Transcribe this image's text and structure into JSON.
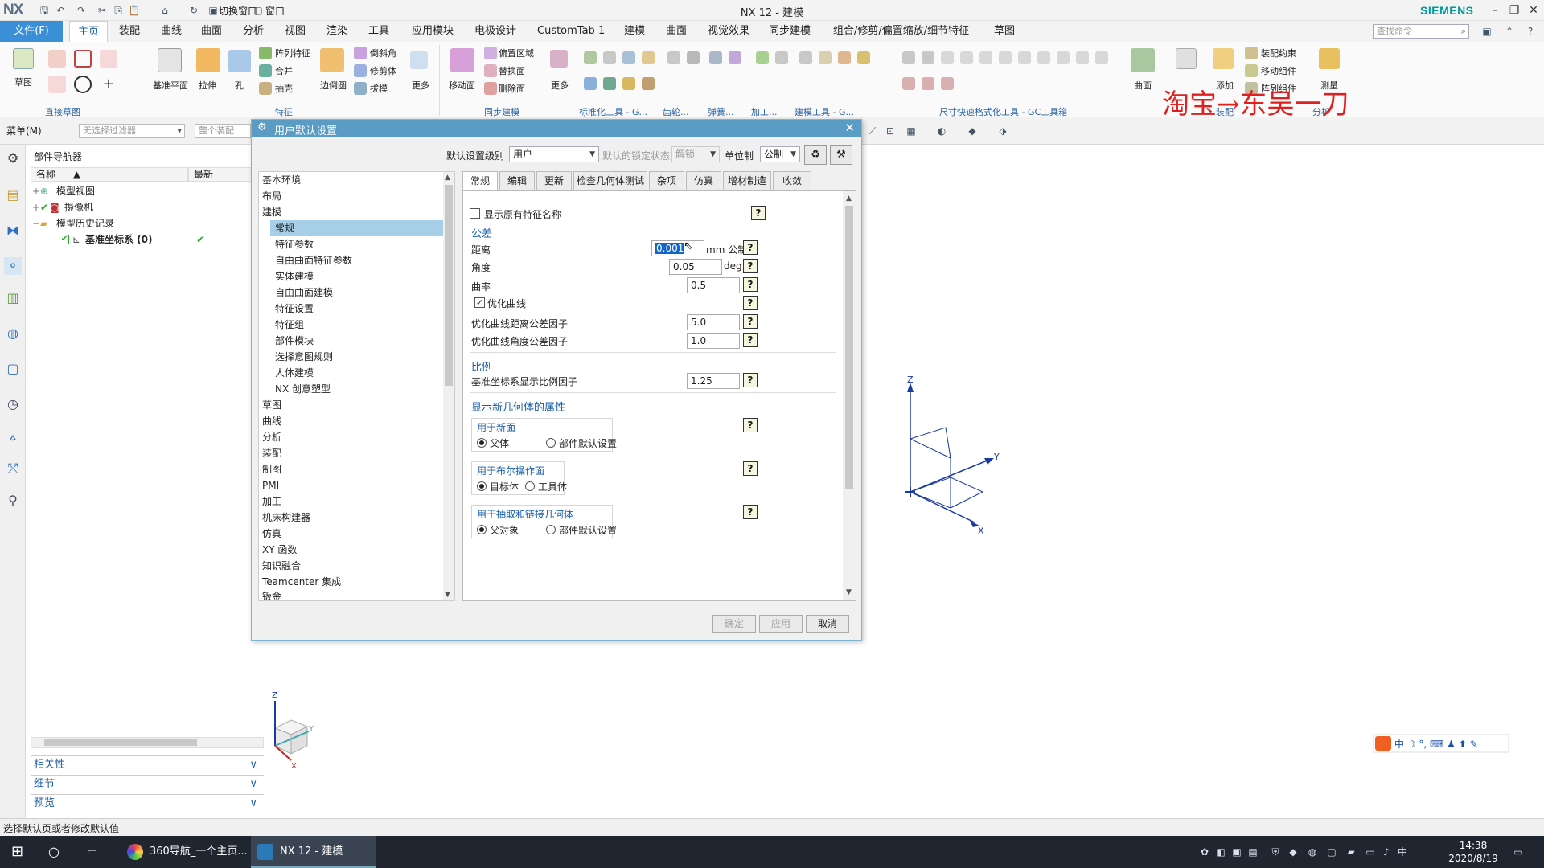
{
  "window": {
    "title": "NX 12 - 建模",
    "brand": "SIEMENS",
    "app_logo": "NX",
    "quick_switch": "切换窗口",
    "quick_window": "窗口"
  },
  "menu": {
    "file": "文件(F)",
    "tabs": [
      "主页",
      "装配",
      "曲线",
      "曲面",
      "分析",
      "视图",
      "渲染",
      "工具",
      "应用模块",
      "电极设计",
      "CustomTab 1",
      "建模",
      "曲面",
      "视觉效果",
      "同步建模",
      "组合/修剪/偏置缩放/细节特征",
      "草图"
    ],
    "active_tab": "主页",
    "search_placeholder": "查找命令"
  },
  "ribbon": {
    "labels": {
      "sketch": "草图",
      "datum_plane": "基准平面",
      "extrude": "拉伸",
      "hole": "孔",
      "pattern_feature": "阵列特征",
      "unite": "合并",
      "shell": "抽壳",
      "edge_blend": "边倒圆",
      "chamfer": "倒斜角",
      "trim_body": "修剪体",
      "draft": "拔模",
      "more1": "更多",
      "move_face": "移动面",
      "offset_region": "偏置区域",
      "replace_face": "替换面",
      "delete_face": "删除面",
      "more2": "更多",
      "surface": "曲面",
      "assembly_constraint": "装配约束",
      "move_component": "移动组件",
      "array_component": "阵列组件",
      "add": "添加",
      "measure": "测量"
    },
    "groups": [
      "直接草图",
      "特征",
      "同步建模",
      "标准化工具 - G...",
      "齿轮...",
      "弹簧...",
      "加工...",
      "建模工具 - G...",
      "尺寸快速格式化工具 - GC工具箱",
      "装配",
      "分析"
    ],
    "watermark": "淘宝→东吴一刀"
  },
  "selection_bar": {
    "menu": "菜单(M)",
    "filter": "无选择过滤器",
    "scope": "整个装配"
  },
  "part_navigator": {
    "title": "部件导航器",
    "col_name": "名称",
    "col_latest": "最新",
    "items": [
      {
        "label": "模型视图"
      },
      {
        "label": "摄像机"
      },
      {
        "label": "模型历史记录"
      },
      {
        "label": "基准坐标系 (0)",
        "latest": "✔"
      }
    ],
    "accordion": [
      "相关性",
      "细节",
      "预览"
    ]
  },
  "dialog": {
    "title": "用户默认设置",
    "level_label": "默认设置级别",
    "level_value": "用户",
    "lock_label": "默认的锁定状态",
    "lock_value": "解锁",
    "units_label": "单位制",
    "units_value": "公制",
    "categories": [
      "基本环境",
      "布局",
      "建模",
      "常规",
      "特征参数",
      "自由曲面特征参数",
      "实体建模",
      "自由曲面建模",
      "特征设置",
      "特征组",
      "部件模块",
      "选择意图规则",
      "人体建模",
      "NX 创意塑型",
      "草图",
      "曲线",
      "分析",
      "装配",
      "制图",
      "PMI",
      "加工",
      "机床构建器",
      "仿真",
      "XY 函数",
      "知识融合",
      "Teamcenter 集成",
      "钣金"
    ],
    "selected_category": "常规",
    "tabs": [
      "常规",
      "编辑",
      "更新",
      "检查几何体测试",
      "杂项",
      "仿真",
      "增材制造",
      "收敛"
    ],
    "active_tab": "常规",
    "show_original_feature_name": "显示原有特征名称",
    "tolerance": {
      "section": "公差",
      "distance_label": "距离",
      "distance_value": "0.001",
      "distance_unit": "mm 公制",
      "angle_label": "角度",
      "angle_value": "0.05",
      "angle_unit": "deg",
      "curvature_label": "曲率",
      "curvature_value": "0.5",
      "optimize_curve": "优化曲线",
      "opt_dist_label": "优化曲线距离公差因子",
      "opt_dist_value": "5.0",
      "opt_angle_label": "优化曲线角度公差因子",
      "opt_angle_value": "1.0"
    },
    "scale": {
      "section": "比例",
      "csys_label": "基准坐标系显示比例因子",
      "csys_value": "1.25"
    },
    "new_geometry": {
      "section": "显示新几何体的属性",
      "new_face": "用于新面",
      "parent_body": "父体",
      "part_default1": "部件默认设置",
      "boolean": "用于布尔操作面",
      "target_body": "目标体",
      "tool_body": "工具体",
      "extract": "用于抽取和链接几何体",
      "parent_object": "父对象",
      "part_default2": "部件默认设置"
    },
    "help_glyph": "?",
    "buttons": {
      "ok": "确定",
      "apply": "应用",
      "cancel": "取消"
    }
  },
  "status": "选择默认页或者修改默认值",
  "taskbar": {
    "app1": "360导航_一个主页...",
    "app2": "NX 12 - 建模",
    "time": "14:38",
    "date": "2020/8/19"
  },
  "csys_axes": {
    "x": "X",
    "y": "Y",
    "z": "Z"
  },
  "colors": {
    "accent": "#3a8fd6",
    "dialog_header": "#5a9cc4",
    "section": "#1b5ea8",
    "watermark": "#e02020",
    "brand": "#009999"
  }
}
